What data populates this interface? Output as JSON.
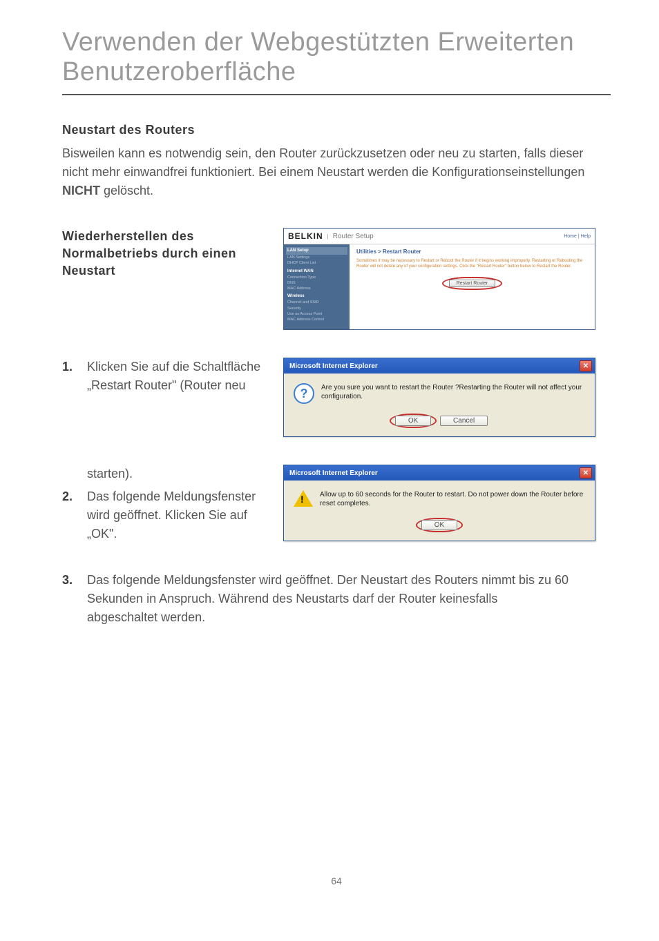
{
  "title": "Verwenden der Webgestützten Erweiterten Benutzeroberfläche",
  "sub1": "Neustart des Routers",
  "intro_pre": "Bisweilen kann es notwendig sein, den Router zurückzusetzen oder neu zu starten, falls dieser nicht mehr einwandfrei funktioniert. Bei einem Neustart werden die Konfigurationseinstellungen ",
  "intro_bold": "NICHT",
  "intro_post": " gelöscht.",
  "sub2": "Wiederherstellen des Normalbetriebs durch einen Neustart",
  "belkin": {
    "logo": "BELKIN",
    "setup": "Router Setup",
    "home": "Home | Help",
    "side": {
      "lan": "LAN Setup",
      "lan1": "LAN Settings",
      "lan2": "DHCP Client List",
      "wan": "Internet WAN",
      "wan1": "Connection Type",
      "wan2": "DNS",
      "wan3": "MAC Address",
      "wl": "Wireless",
      "wl1": "Channel and SSID",
      "wl2": "Security",
      "wl3": "Use as Access Point",
      "wl4": "MAC Address Control"
    },
    "crumb": "Utilities > Restart Router",
    "desc": "Sometimes it may be necessary to Restart or Reboot the Router if it begins working improperly. Restarting or Rebooting the Router will not delete any of your configuration settings. Click the \"Restart Router\" button below to Restart the Router.",
    "btn": "Restart Router"
  },
  "step1": {
    "num": "1.",
    "text": "Klicken Sie auf die Schaltfläche „Restart Router\" (Router neu",
    "cont": "starten)."
  },
  "dialog1": {
    "title": "Microsoft Internet Explorer",
    "msg": "Are you sure you want to restart the Router ?Restarting the Router will not affect your configuration.",
    "ok": "OK",
    "cancel": "Cancel"
  },
  "step2": {
    "num": "2.",
    "text": "Das folgende Meldungsfenster wird geöffnet. Klicken Sie auf „OK\"."
  },
  "dialog2": {
    "title": "Microsoft Internet Explorer",
    "msg": "Allow up to 60 seconds for the Router to restart. Do not power down the Router before reset completes.",
    "ok": "OK"
  },
  "step3": {
    "num": "3.",
    "text": "Das folgende Meldungsfenster wird geöffnet. Der Neustart des Routers nimmt bis zu 60 Sekunden in Anspruch. Während des Neustarts darf der Router keinesfalls abgeschaltet werden."
  },
  "pagenum": "64"
}
